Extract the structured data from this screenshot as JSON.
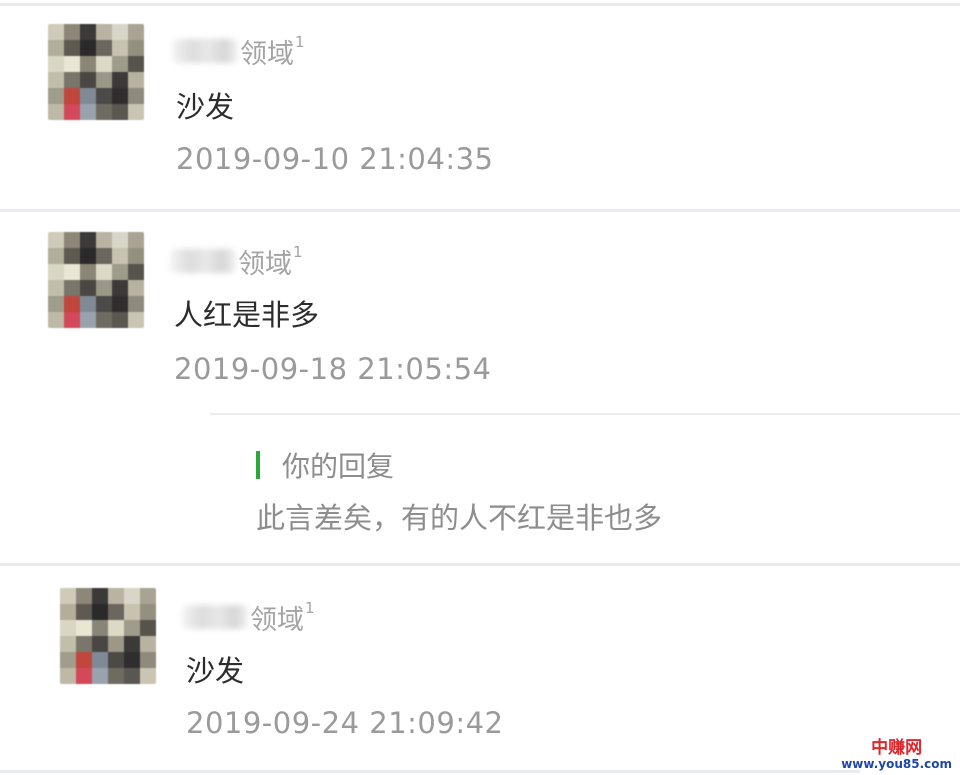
{
  "comments": [
    {
      "author_suffix": "领域",
      "level": "1",
      "content": "沙发",
      "time": "2019-09-10 21:04:35"
    },
    {
      "author_suffix": "领域",
      "level": "1",
      "content": "人红是非多",
      "time": "2019-09-18 21:05:54",
      "reply": {
        "label": "你的回复",
        "text": "此言差矣，有的人不红是非也多"
      }
    },
    {
      "author_suffix": "领域",
      "level": "1",
      "content": "沙发",
      "time": "2019-09-24 21:09:42"
    }
  ],
  "watermark": {
    "name": "中赚网",
    "url": "www.you85.com"
  },
  "colors": {
    "reply_accent": "#2aa83a",
    "watermark_red": "#e0262b",
    "watermark_blue": "#1f47a7"
  }
}
